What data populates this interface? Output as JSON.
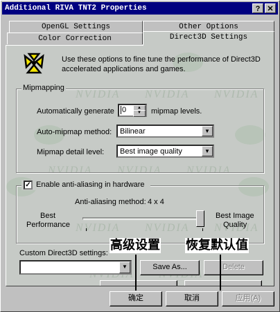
{
  "window": {
    "title": "Additional RIVA TNT2 Properties",
    "help_btn": "?",
    "close_btn": "✕"
  },
  "tabs": {
    "opengl": "OpenGL Settings",
    "other": "Other Options",
    "color": "Color Correction",
    "direct3d": "Direct3D Settings"
  },
  "intro": {
    "text_line1": "Use these options to fine tune the performance of Direct3D",
    "text_line2": "accelerated applications and games."
  },
  "watermark": "NVIDIA",
  "mipmapping": {
    "group_label": "Mipmapping",
    "auto_generate_label": "Automatically generate",
    "auto_generate_value": "0",
    "levels_label": "mipmap levels.",
    "method_label": "Auto-mipmap method:",
    "method_value": "Bilinear",
    "detail_label": "Mipmap detail level:",
    "detail_value": "Best image quality"
  },
  "antialias": {
    "checkbox_label": "Enable anti-aliasing in hardware",
    "checked": "✓",
    "method_label": "Anti-aliasing method:",
    "method_value": "4 x 4",
    "left_label_1": "Best",
    "left_label_2": "Performance",
    "right_label_1": "Best Image",
    "right_label_2": "Quality",
    "slider_level": 1.0
  },
  "custom": {
    "label": "Custom Direct3D settings:",
    "value": "",
    "save_as": "Save As...",
    "delete": "Delete"
  },
  "annotations": {
    "advanced": "高级设置",
    "restore": "恢复默认值"
  },
  "footer": {
    "ok": "确定",
    "cancel": "取消",
    "apply": "应用(A)"
  }
}
